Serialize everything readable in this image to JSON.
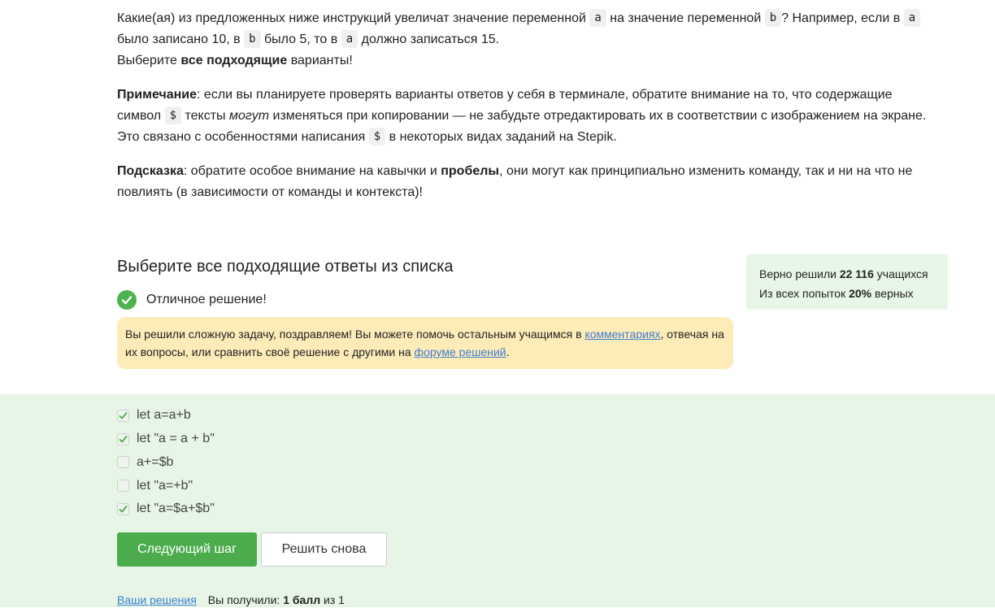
{
  "problem": {
    "p1_part1": "Какие(ая) из предложенных ниже инструкций увеличат значение переменной ",
    "var_a": "a",
    "p1_part2": " на значение переменной ",
    "var_b": "b",
    "p1_part3": "? Например, если в ",
    "p1_part4": " было записано 10, в ",
    "p1_part5": " было 5, то в ",
    "p1_part6": " должно записаться 15.",
    "choose_prefix": "Выберите ",
    "choose_bold": "все подходящие",
    "choose_suffix": " варианты!",
    "note_label": "Примечание",
    "note_part1": ": если вы планируете проверять варианты ответов у себя в терминале, обратите внимание на то, что содержащие символ ",
    "dollar": "$",
    "note_part2": " тексты ",
    "note_italic": "могут",
    "note_part3": " изменяться при копировании — не забудьте отредактировать их в соответствии с изображением на экране. Это связано с особенностями написания ",
    "note_part4": " в некоторых видах заданий на Stepik.",
    "hint_label": "Подсказка",
    "hint_part1": ": обратите особое внимание на кавычки и ",
    "hint_bold": "пробелы",
    "hint_part2": ", они могут как принципиально изменить команду, так и ни на что не повлиять (в зависимости от команды и контекста)!"
  },
  "quiz": {
    "title": "Выберите все подходящие ответы из списка",
    "success_text": "Отличное решение!",
    "notice_part1": "Вы решили сложную задачу, поздравляем! Вы можете помочь остальным учащимся в ",
    "notice_link1": "комментариях",
    "notice_part2": ", отвечая на их вопросы, или сравнить своё решение с другими на ",
    "notice_link2": "форуме решений",
    "notice_part3": "."
  },
  "stats": {
    "solved_prefix": "Верно решили ",
    "solved_count": "22 116",
    "solved_suffix": " учащихся",
    "attempts_prefix": "Из всех попыток ",
    "attempts_percent": "20%",
    "attempts_suffix": " верных"
  },
  "options": [
    {
      "label": "let a=a+b",
      "checked": true
    },
    {
      "label": "let \"a = a + b\"",
      "checked": true
    },
    {
      "label": "a+=$b",
      "checked": false
    },
    {
      "label": "let \"a=+b\"",
      "checked": false
    },
    {
      "label": "let \"a=$a+$b\"",
      "checked": true
    }
  ],
  "buttons": {
    "next_step": "Следующий шаг",
    "solve_again": "Решить снова"
  },
  "footer": {
    "your_solutions": "Ваши решения",
    "score_prefix": "Вы получили: ",
    "score_bold": "1 балл",
    "score_suffix": " из 1"
  },
  "colors": {
    "accent_green": "#4cab4c",
    "success_bg": "#e6f5e6",
    "notice_bg": "#fdebb8",
    "link": "#3d7ed1"
  }
}
